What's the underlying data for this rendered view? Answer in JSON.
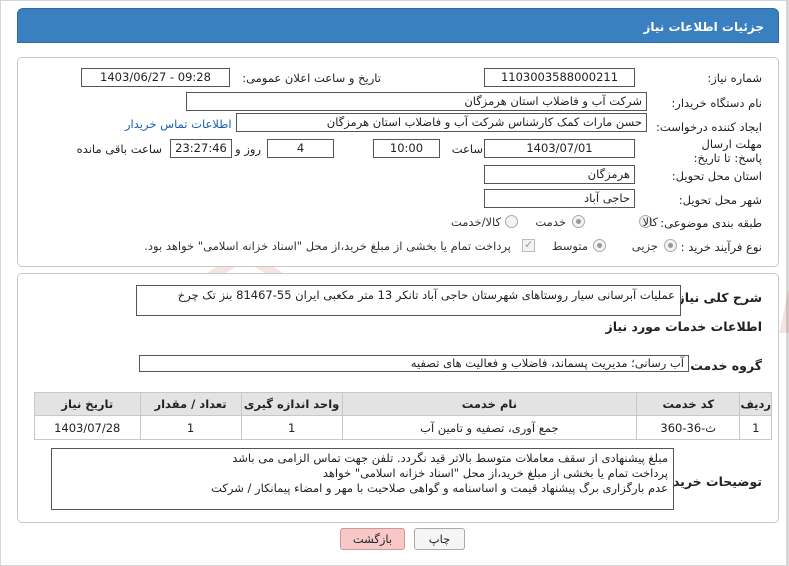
{
  "header": {
    "title": "جزئیات اطلاعات نیاز"
  },
  "form": {
    "need_number_label": "شماره نیاز:",
    "need_number": "1103003588000211",
    "announce_label": "تاریخ و ساعت اعلان عمومی:",
    "announce_value": "1403/06/27 - 09:28",
    "buyer_org_label": "نام دستگاه خریدار:",
    "buyer_org": "شرکت آب و فاضلاب استان هرمزگان",
    "creator_label": "ایجاد کننده درخواست:",
    "creator": "حسن مارات کمک کارشناس شرکت آب و فاضلاب استان هرمزگان",
    "contact_link": "اطلاعات تماس خریدار",
    "deadline_label": "مهلت ارسال پاسخ: تا تاریخ:",
    "deadline_date": "1403/07/01",
    "time_label": "ساعت",
    "deadline_time": "10:00",
    "days_value": "4",
    "days_label": "روز و",
    "remaining_time": "23:27:46",
    "remaining_label": "ساعت باقی مانده",
    "province_label": "استان محل تحویل:",
    "province": "هرمزگان",
    "city_label": "شهر محل تحویل:",
    "city": "حاجی آباد",
    "category_label": "طبقه بندی موضوعی:",
    "category_options": [
      "کالا",
      "خدمت",
      "کالا/خدمت"
    ],
    "category_selected": "خدمت",
    "process_label": "نوع فرآیند خرید :",
    "process_options": [
      "جزیی",
      "متوسط"
    ],
    "process_selected": "جزیی",
    "payment_note": "پرداخت تمام یا بخشی از مبلغ خرید،از محل \"اسناد خزانه اسلامی\" خواهد بود."
  },
  "details": {
    "summary_label": "شرح کلی نیاز:",
    "summary": "عملیات آبرسانی سیار روستاهای شهرستان حاجی آباد تانکر 13 متر مکعبی ایران 55-81467 بنز تک چرخ",
    "services_title": "اطلاعات خدمات مورد نیاز",
    "service_group_label": "گروه خدمت:",
    "service_group": "آب رسانی؛ مدیریت پسماند، فاضلاب و فعالیت های تصفیه",
    "table": {
      "headers": [
        "ردیف",
        "کد خدمت",
        "نام خدمت",
        "واحد اندازه گیری",
        "تعداد / مقدار",
        "تاریخ نیاز"
      ],
      "rows": [
        [
          "1",
          "ث-36-360",
          "جمع آوری، تصفیه و تامین آب",
          "1",
          "1",
          "1403/07/28"
        ]
      ]
    },
    "buyer_notes_label": "توضیحات خریدار:",
    "buyer_notes": [
      "مبلغ پیشنهادی از سقف معاملات متوسط بالاتر قید نگردد. تلفن جهت تماس الزامی می باشد",
      "پرداخت تمام یا بخشی از مبلغ خرید،از محل \"اسناد خزانه اسلامی\" خواهد",
      "عدم بارگزاری برگ پیشنهاد قیمت و اساسنامه و گواهی صلاحیت با مهر و امضاء پیمانکار / شرکت"
    ]
  },
  "buttons": {
    "print": "چاپ",
    "back": "بازگشت"
  },
  "watermark": {
    "text": "AriaTender.neT"
  }
}
